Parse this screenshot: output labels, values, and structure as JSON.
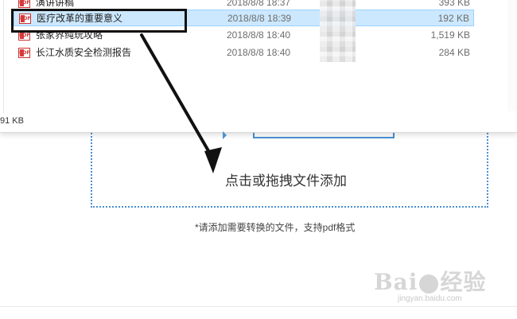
{
  "explorer": {
    "files": [
      {
        "name": "演讲讲稿",
        "date": "2018/8/8 18:37",
        "size": "393 KB",
        "selected": false
      },
      {
        "name": "医疗改革的重要意义",
        "date": "2018/8/8 18:39",
        "size": "192 KB",
        "selected": true
      },
      {
        "name": "张家界纯玩攻略",
        "date": "2018/8/8 18:40",
        "size": "1,519 KB",
        "selected": false
      },
      {
        "name": "长江水质安全检测报告",
        "date": "2018/8/8 18:40",
        "size": "284 KB",
        "selected": false
      }
    ],
    "status": "91 KB",
    "file_icon": "pdf-file-icon",
    "icon_label": "PDF"
  },
  "converter": {
    "drop_text": "点击或拖拽文件添加",
    "hint": "*请添加需要转换的文件，支持pdf格式"
  },
  "watermark": {
    "brand": "Bai",
    "brand_suffix": "经验",
    "url": "jingyan.baidu.com"
  },
  "colors": {
    "selection": "#cce8ff",
    "accent": "#4a8fd0",
    "annotation": "#111111"
  }
}
